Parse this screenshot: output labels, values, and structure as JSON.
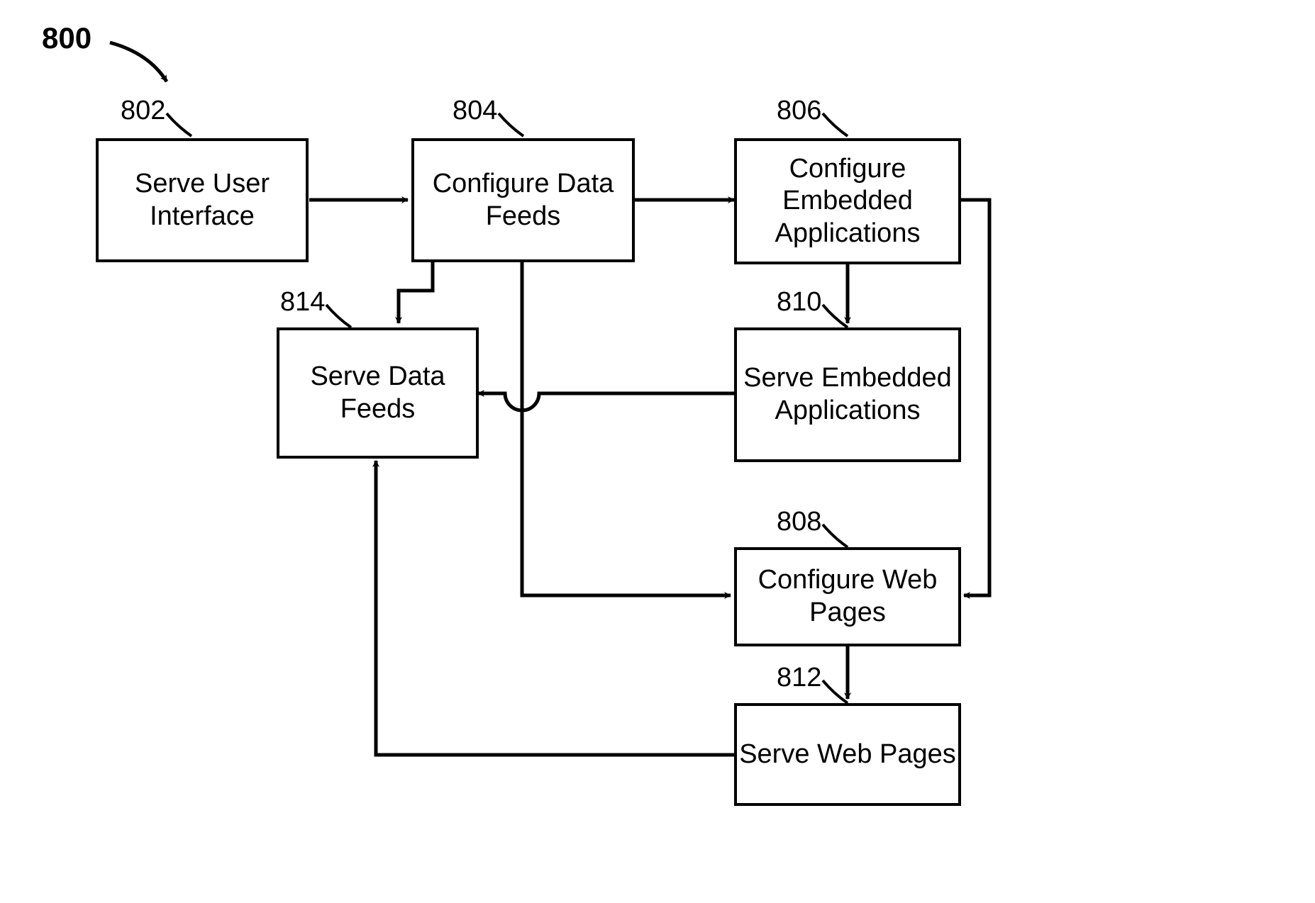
{
  "figure": {
    "number": "800"
  },
  "nodes": {
    "n802": {
      "ref": "802",
      "label": "Serve User Interface"
    },
    "n804": {
      "ref": "804",
      "label": "Configure Data Feeds"
    },
    "n806": {
      "ref": "806",
      "label": "Configure Embedded Applications"
    },
    "n808": {
      "ref": "808",
      "label": "Configure Web Pages"
    },
    "n810": {
      "ref": "810",
      "label": "Serve Embedded Applications"
    },
    "n812": {
      "ref": "812",
      "label": "Serve Web Pages"
    },
    "n814": {
      "ref": "814",
      "label": "Serve Data Feeds"
    }
  }
}
